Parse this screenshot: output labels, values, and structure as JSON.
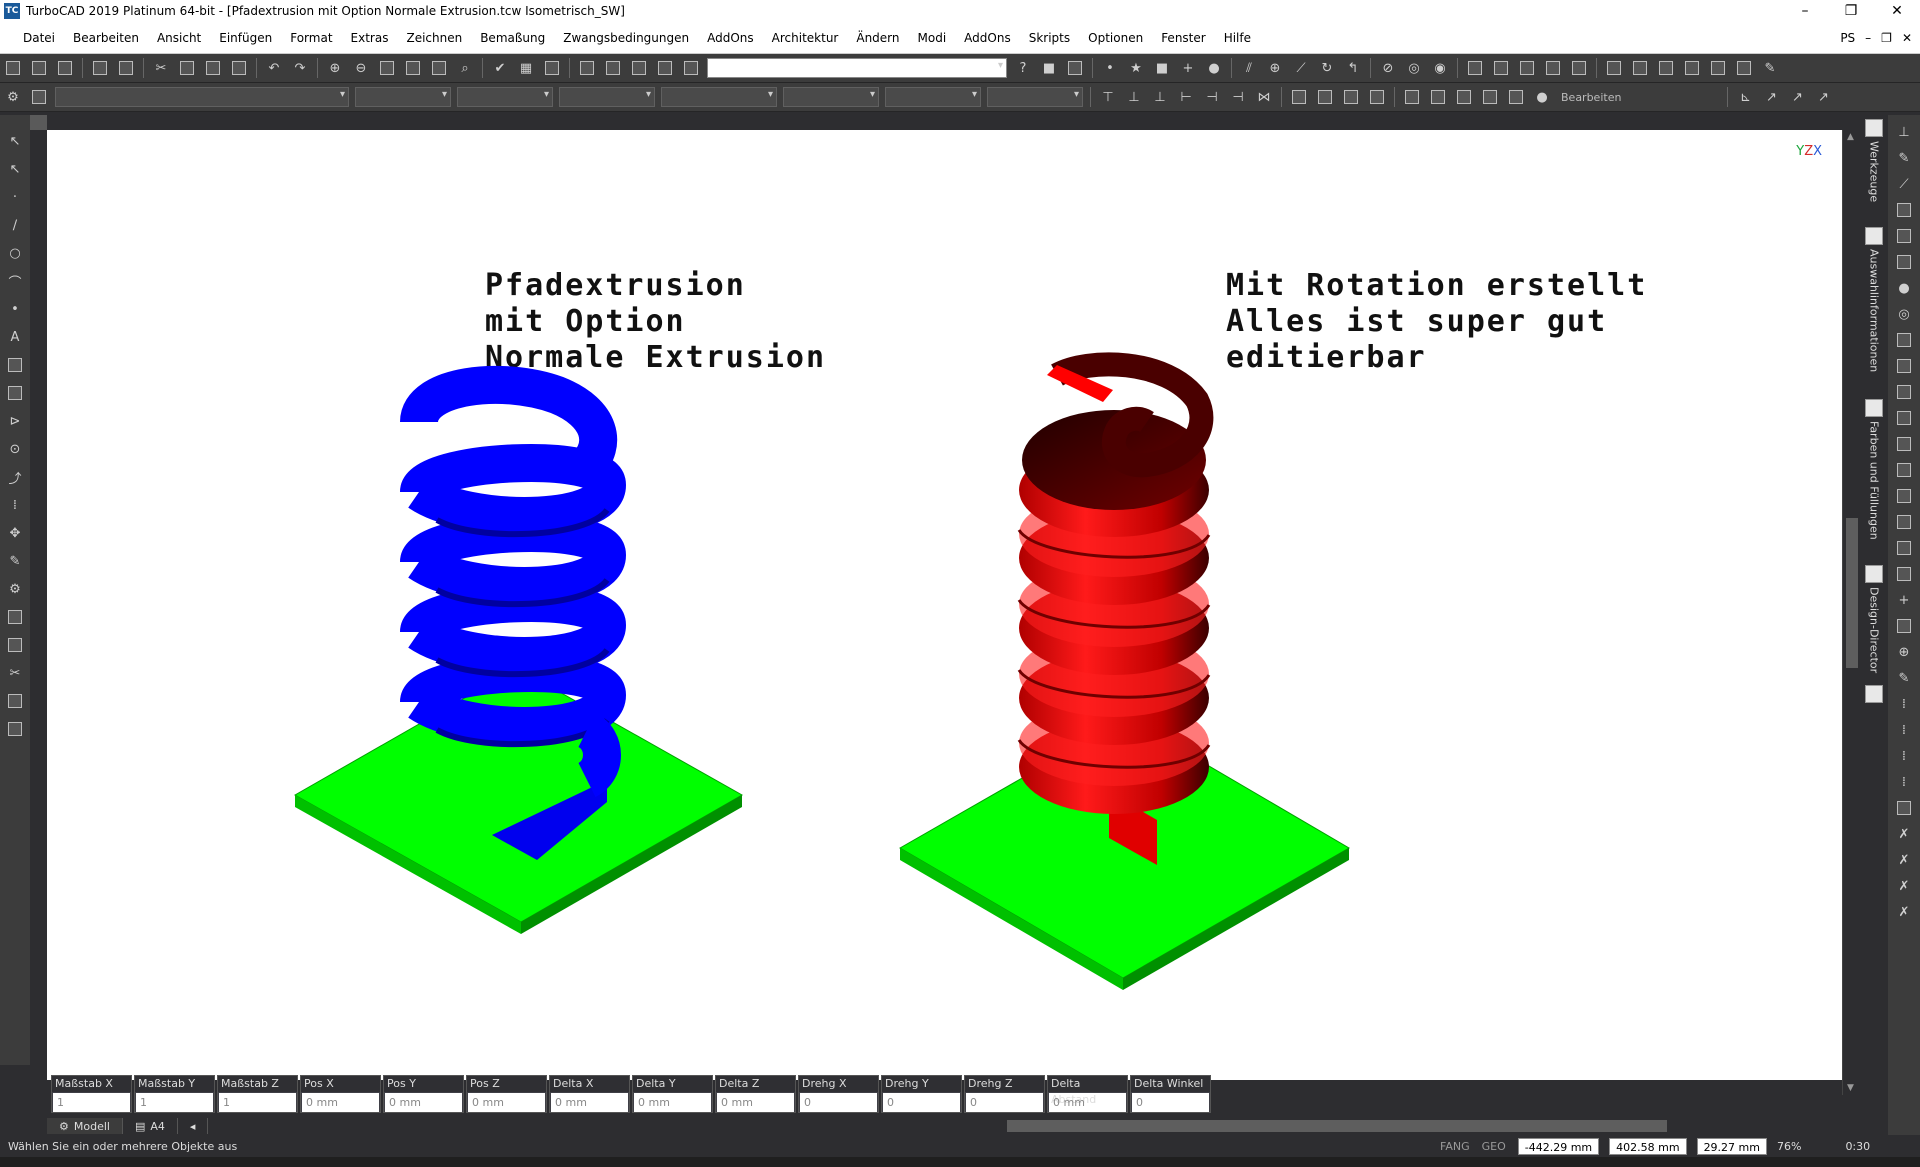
{
  "window": {
    "app_badge": "TC",
    "title": "TurboCAD 2019 Platinum 64-bit - [Pfadextrusion mit Option Normale Extrusion.tcw Isometrisch_SW]",
    "minimize": "–",
    "maximize": "❐",
    "close": "✕"
  },
  "menu": {
    "items": [
      "Datei",
      "Bearbeiten",
      "Ansicht",
      "Einfügen",
      "Format",
      "Extras",
      "Zeichnen",
      "Bemaßung",
      "Zwangsbedingungen",
      "AddOns",
      "Architektur",
      "Ändern",
      "Modi",
      "AddOns",
      "Skripts",
      "Optionen",
      "Fenster",
      "Hilfe"
    ],
    "badge": "PS",
    "doc_minimize": "–",
    "doc_restore": "❐",
    "doc_close": "✕"
  },
  "toolbar": {
    "edit_label": "Bearbeiten"
  },
  "canvas": {
    "left_label": "Pfadextrusion\nmit Option\nNormale Extrusion",
    "right_label": "Mit Rotation erstellt\nAlles ist super gut\neditierbar",
    "axis": {
      "y": "Y",
      "z": "Z",
      "x": "X"
    },
    "colors": {
      "blue_spring": "#0000ff",
      "red_spring": "#e00000",
      "base_plate": "#00ff00"
    }
  },
  "inspector": {
    "fields": [
      {
        "label": "Maßstab X",
        "value": "1"
      },
      {
        "label": "Maßstab Y",
        "value": "1"
      },
      {
        "label": "Maßstab Z",
        "value": "1"
      },
      {
        "label": "Pos X",
        "value": "0 mm"
      },
      {
        "label": "Pos Y",
        "value": "0 mm"
      },
      {
        "label": "Pos Z",
        "value": "0 mm"
      },
      {
        "label": "Delta X",
        "value": "0 mm"
      },
      {
        "label": "Delta Y",
        "value": "0 mm"
      },
      {
        "label": "Delta Z",
        "value": "0 mm"
      },
      {
        "label": "Drehg X",
        "value": "0"
      },
      {
        "label": "Drehg Y",
        "value": "0"
      },
      {
        "label": "Drehg Z",
        "value": "0"
      },
      {
        "label": "Delta Abstand",
        "value": "0 mm"
      },
      {
        "label": "Delta Winkel",
        "value": "0"
      }
    ]
  },
  "tabs": {
    "model": "Modell",
    "layout": "A4",
    "nav": "◂"
  },
  "status": {
    "message": "Wählen Sie ein oder mehrere Objekte aus",
    "snap_fang": "FANG",
    "snap_geo": "GEO",
    "x": "-442.29 mm",
    "y": "402.58 mm",
    "z": "29.27 mm",
    "zoom": "76%",
    "time": "0:30"
  },
  "right_panel": {
    "tab_tools": "Werkzeuge",
    "tab_selection": "Auswahlinformationen",
    "tab_colors": "Farben und Füllungen",
    "tab_design": "Design-Director"
  }
}
